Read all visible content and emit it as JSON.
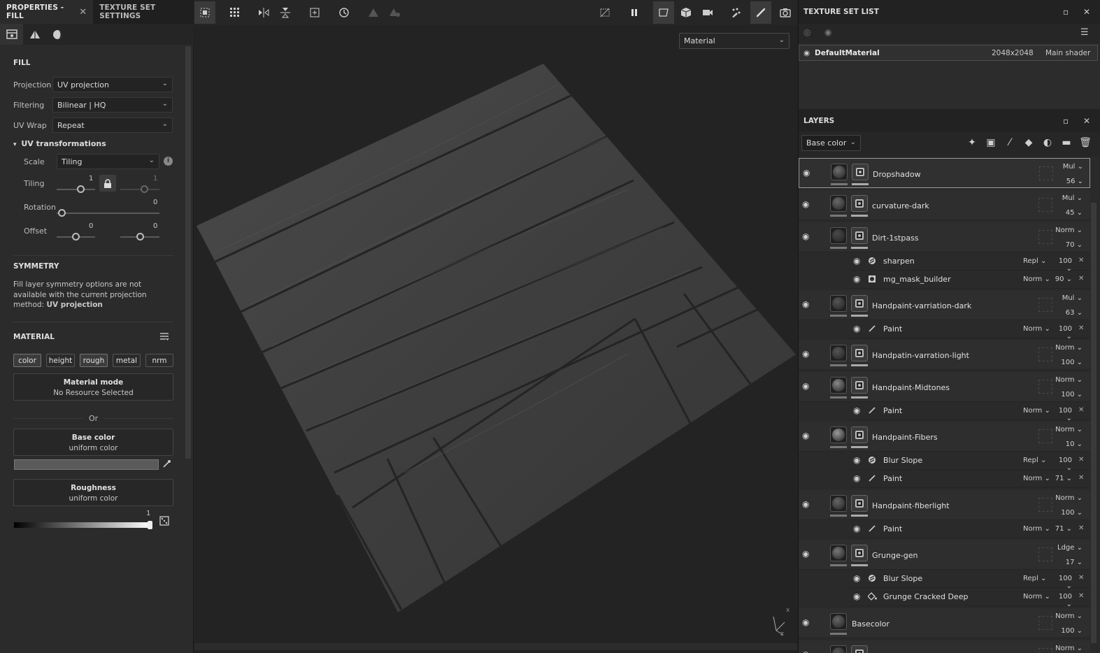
{
  "left_tabs": {
    "properties": "PROPERTIES - FILL",
    "close": "✕",
    "texture_set_settings": "TEXTURE SET SETTINGS"
  },
  "fill": {
    "header": "FILL",
    "projection_label": "Projection",
    "projection_value": "UV projection",
    "filtering_label": "Filtering",
    "filtering_value": "Bilinear | HQ",
    "uvwrap_label": "UV Wrap",
    "uvwrap_value": "Repeat",
    "uvt_header": "UV transformations",
    "scale_label": "Scale",
    "scale_value": "Tiling",
    "tiling_label": "Tiling",
    "tiling_value_1": "1",
    "tiling_value_2": "1",
    "rotation_label": "Rotation",
    "rotation_value": "0",
    "offset_label": "Offset",
    "offset_value_1": "0",
    "offset_value_2": "0"
  },
  "symmetry": {
    "header": "SYMMETRY",
    "text": "Fill layer symmetry options are not available with the current projection method: ",
    "text_bold": "UV projection"
  },
  "material": {
    "header": "MATERIAL",
    "chips": [
      "color",
      "height",
      "rough",
      "metal",
      "nrm"
    ],
    "mode_title": "Material mode",
    "mode_sub": "No Resource Selected",
    "or": "Or",
    "base_title": "Base color",
    "base_sub": "uniform color",
    "rough_title": "Roughness",
    "rough_sub": "uniform color",
    "rough_value": "1"
  },
  "viewport": {
    "material_dropdown": "Material",
    "axis_x": "x",
    "axis_z": "z"
  },
  "texture_set_list": {
    "header": "TEXTURE SET LIST",
    "row_name": "DefaultMaterial",
    "row_res": "2048x2048",
    "row_shader": "Main shader"
  },
  "layers": {
    "header": "LAYERS",
    "channel": "Base color",
    "items": [
      {
        "name": "Dropshadow",
        "blend": "Mul",
        "opacity": "56"
      },
      {
        "name": "curvature-dark",
        "blend": "Mul",
        "opacity": "45"
      },
      {
        "name": "Dirt-1stpass",
        "blend": "Norm",
        "opacity": "70"
      },
      {
        "name": "Handpaint-varriation-dark",
        "blend": "Mul",
        "opacity": "63"
      },
      {
        "name": "Handpatin-varration-light",
        "blend": "Norm",
        "opacity": "100"
      },
      {
        "name": "Handpaint-Midtones",
        "blend": "Norm",
        "opacity": "100"
      },
      {
        "name": "Handpaint-Fibers",
        "blend": "Norm",
        "opacity": "10"
      },
      {
        "name": "Handpaint-fiberlight",
        "blend": "Norm",
        "opacity": "100"
      },
      {
        "name": "Grunge-gen",
        "blend": "Ldge",
        "opacity": "17"
      },
      {
        "name": "Basecolor",
        "blend": "Norm",
        "opacity": "100"
      },
      {
        "name": "",
        "blend": "Norm",
        "opacity": ""
      }
    ],
    "subs": [
      {
        "name": "sharpen",
        "blend": "Repl",
        "opacity": "100"
      },
      {
        "name": "mg_mask_builder",
        "blend": "Norm",
        "opacity": "90"
      },
      {
        "name": "Paint",
        "blend": "Norm",
        "opacity": "100"
      },
      {
        "name": "Paint",
        "blend": "Norm",
        "opacity": "100"
      },
      {
        "name": "Blur Slope",
        "blend": "Repl",
        "opacity": "100"
      },
      {
        "name": "Paint",
        "blend": "Norm",
        "opacity": "71"
      },
      {
        "name": "Paint",
        "blend": "Norm",
        "opacity": "71"
      },
      {
        "name": "Blur Slope",
        "blend": "Repl",
        "opacity": "100"
      },
      {
        "name": "Grunge Cracked Deep",
        "blend": "Norm",
        "opacity": "100"
      }
    ]
  }
}
